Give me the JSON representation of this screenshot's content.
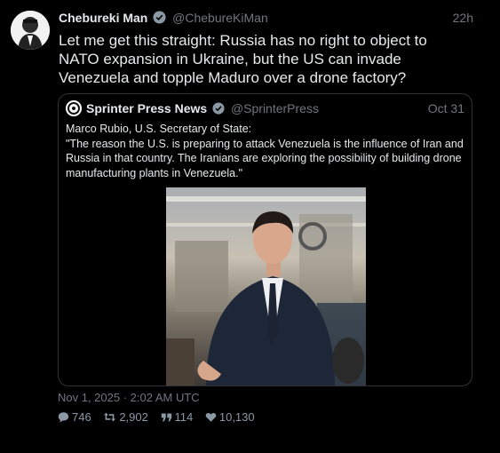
{
  "tweet": {
    "name": "Chebureki Man",
    "handle": "@ChebureKiMan",
    "time": "22h",
    "text": "Let me get this straight: Russia has no right to object to NATO expansion in Ukraine, but the US can invade Venezuela and topple Maduro over a drone factory?",
    "date": "Nov 1, 2025 · 2:02 AM UTC",
    "stats": {
      "replies": "746",
      "retweets": "2,902",
      "quotes": "114",
      "likes": "10,130"
    }
  },
  "quote": {
    "name": "Sprinter Press News",
    "handle": "@SprinterPress",
    "time": "Oct 31",
    "text_line1": "Marco Rubio, U.S. Secretary of State:",
    "text_line2": "\"The reason the U.S. is preparing to attack Venezuela is the influence of Iran and Russia in that country. The Iranians are exploring the possibility of building drone manufacturing plants in Venezuela.\""
  },
  "icons": {
    "verified": "verified-badge-icon",
    "reply": "reply-icon",
    "retweet": "retweet-icon",
    "quote": "quote-icon",
    "like": "heart-icon"
  },
  "colors": {
    "background": "#000000",
    "text": "#e7e9ea",
    "muted": "#71767b",
    "border": "#2f3336"
  }
}
